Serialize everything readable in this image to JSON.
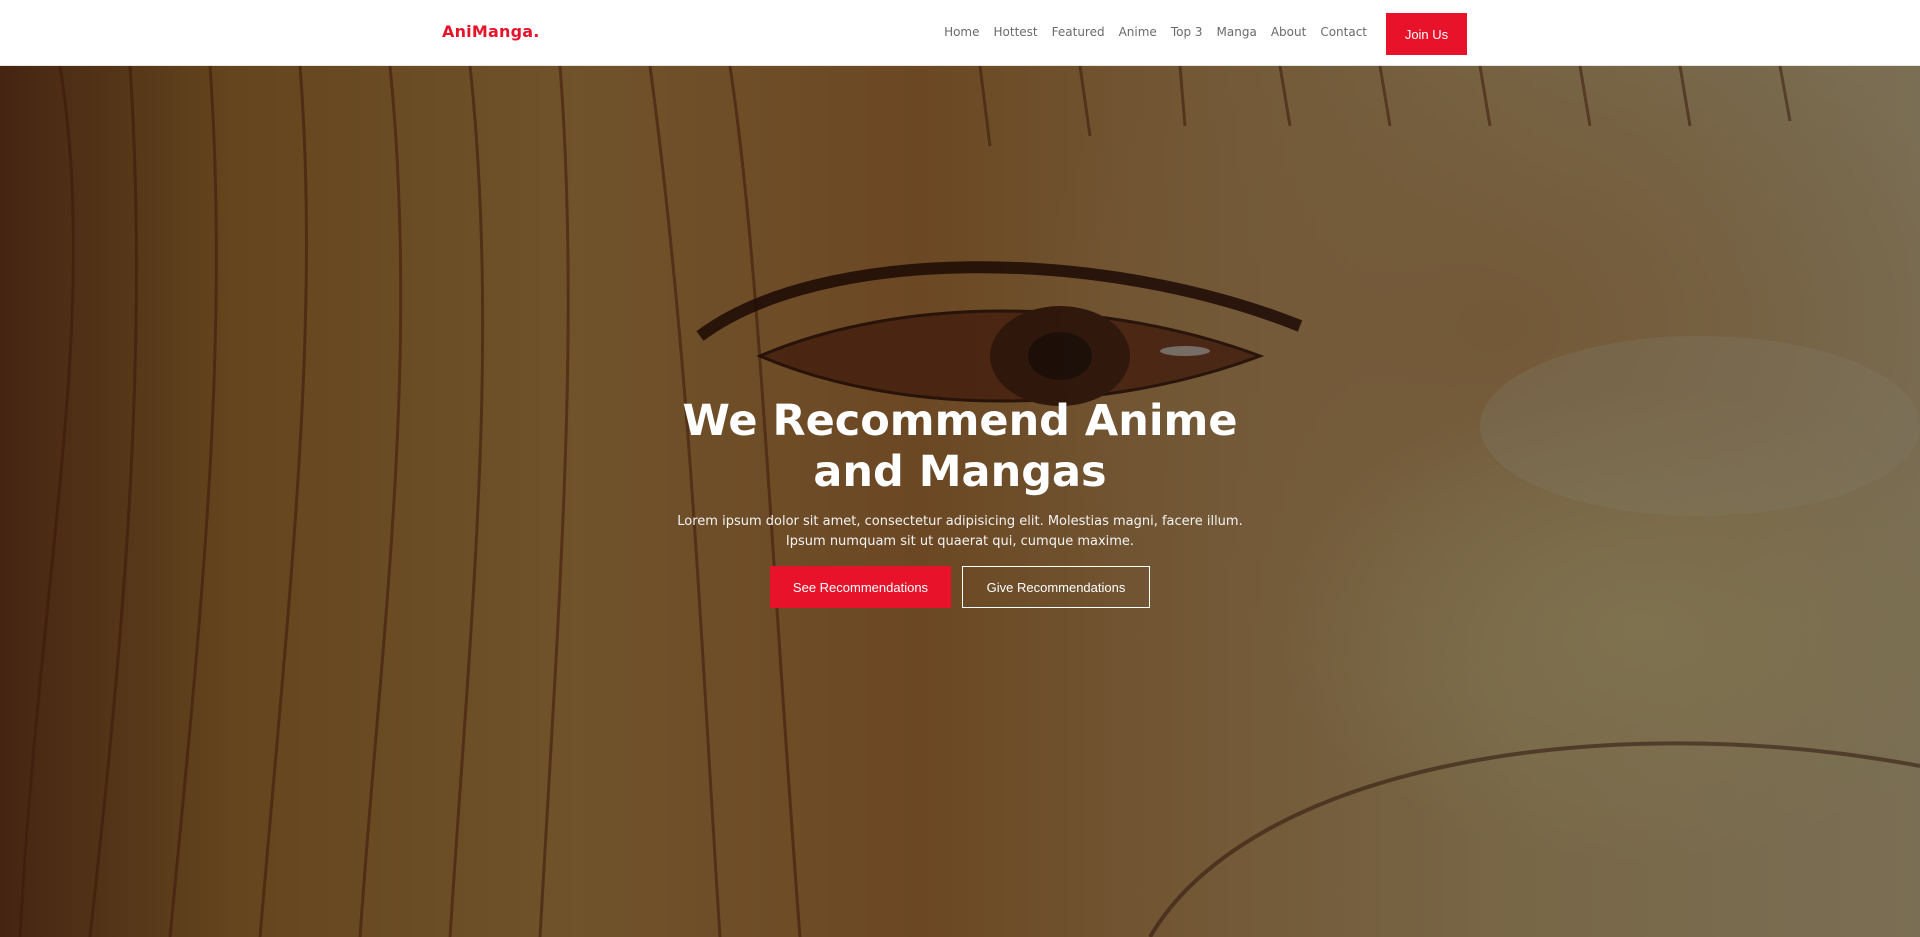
{
  "brand": {
    "logo_text": "AniManga."
  },
  "nav": {
    "items": [
      {
        "label": "Home"
      },
      {
        "label": "Hottest"
      },
      {
        "label": "Featured"
      },
      {
        "label": "Anime"
      },
      {
        "label": "Top 3"
      },
      {
        "label": "Manga"
      },
      {
        "label": "About"
      },
      {
        "label": "Contact"
      }
    ],
    "cta_label": "Join Us"
  },
  "hero": {
    "title": "We Recommend Anime and Mangas",
    "text": "Lorem ipsum dolor sit amet, consectetur adipisicing elit. Molestias magni, facere illum. Ipsum numquam sit ut quaerat qui, cumque maxime.",
    "primary_button": "See Recommendations",
    "secondary_button": "Give Recommendations",
    "background_image": "anime-eye-illustration"
  },
  "colors": {
    "accent": "#e8132b",
    "nav_text": "#6b6b6b",
    "header_bg": "#ffffff",
    "overlay": "rgba(0,0,0,0.5)"
  }
}
